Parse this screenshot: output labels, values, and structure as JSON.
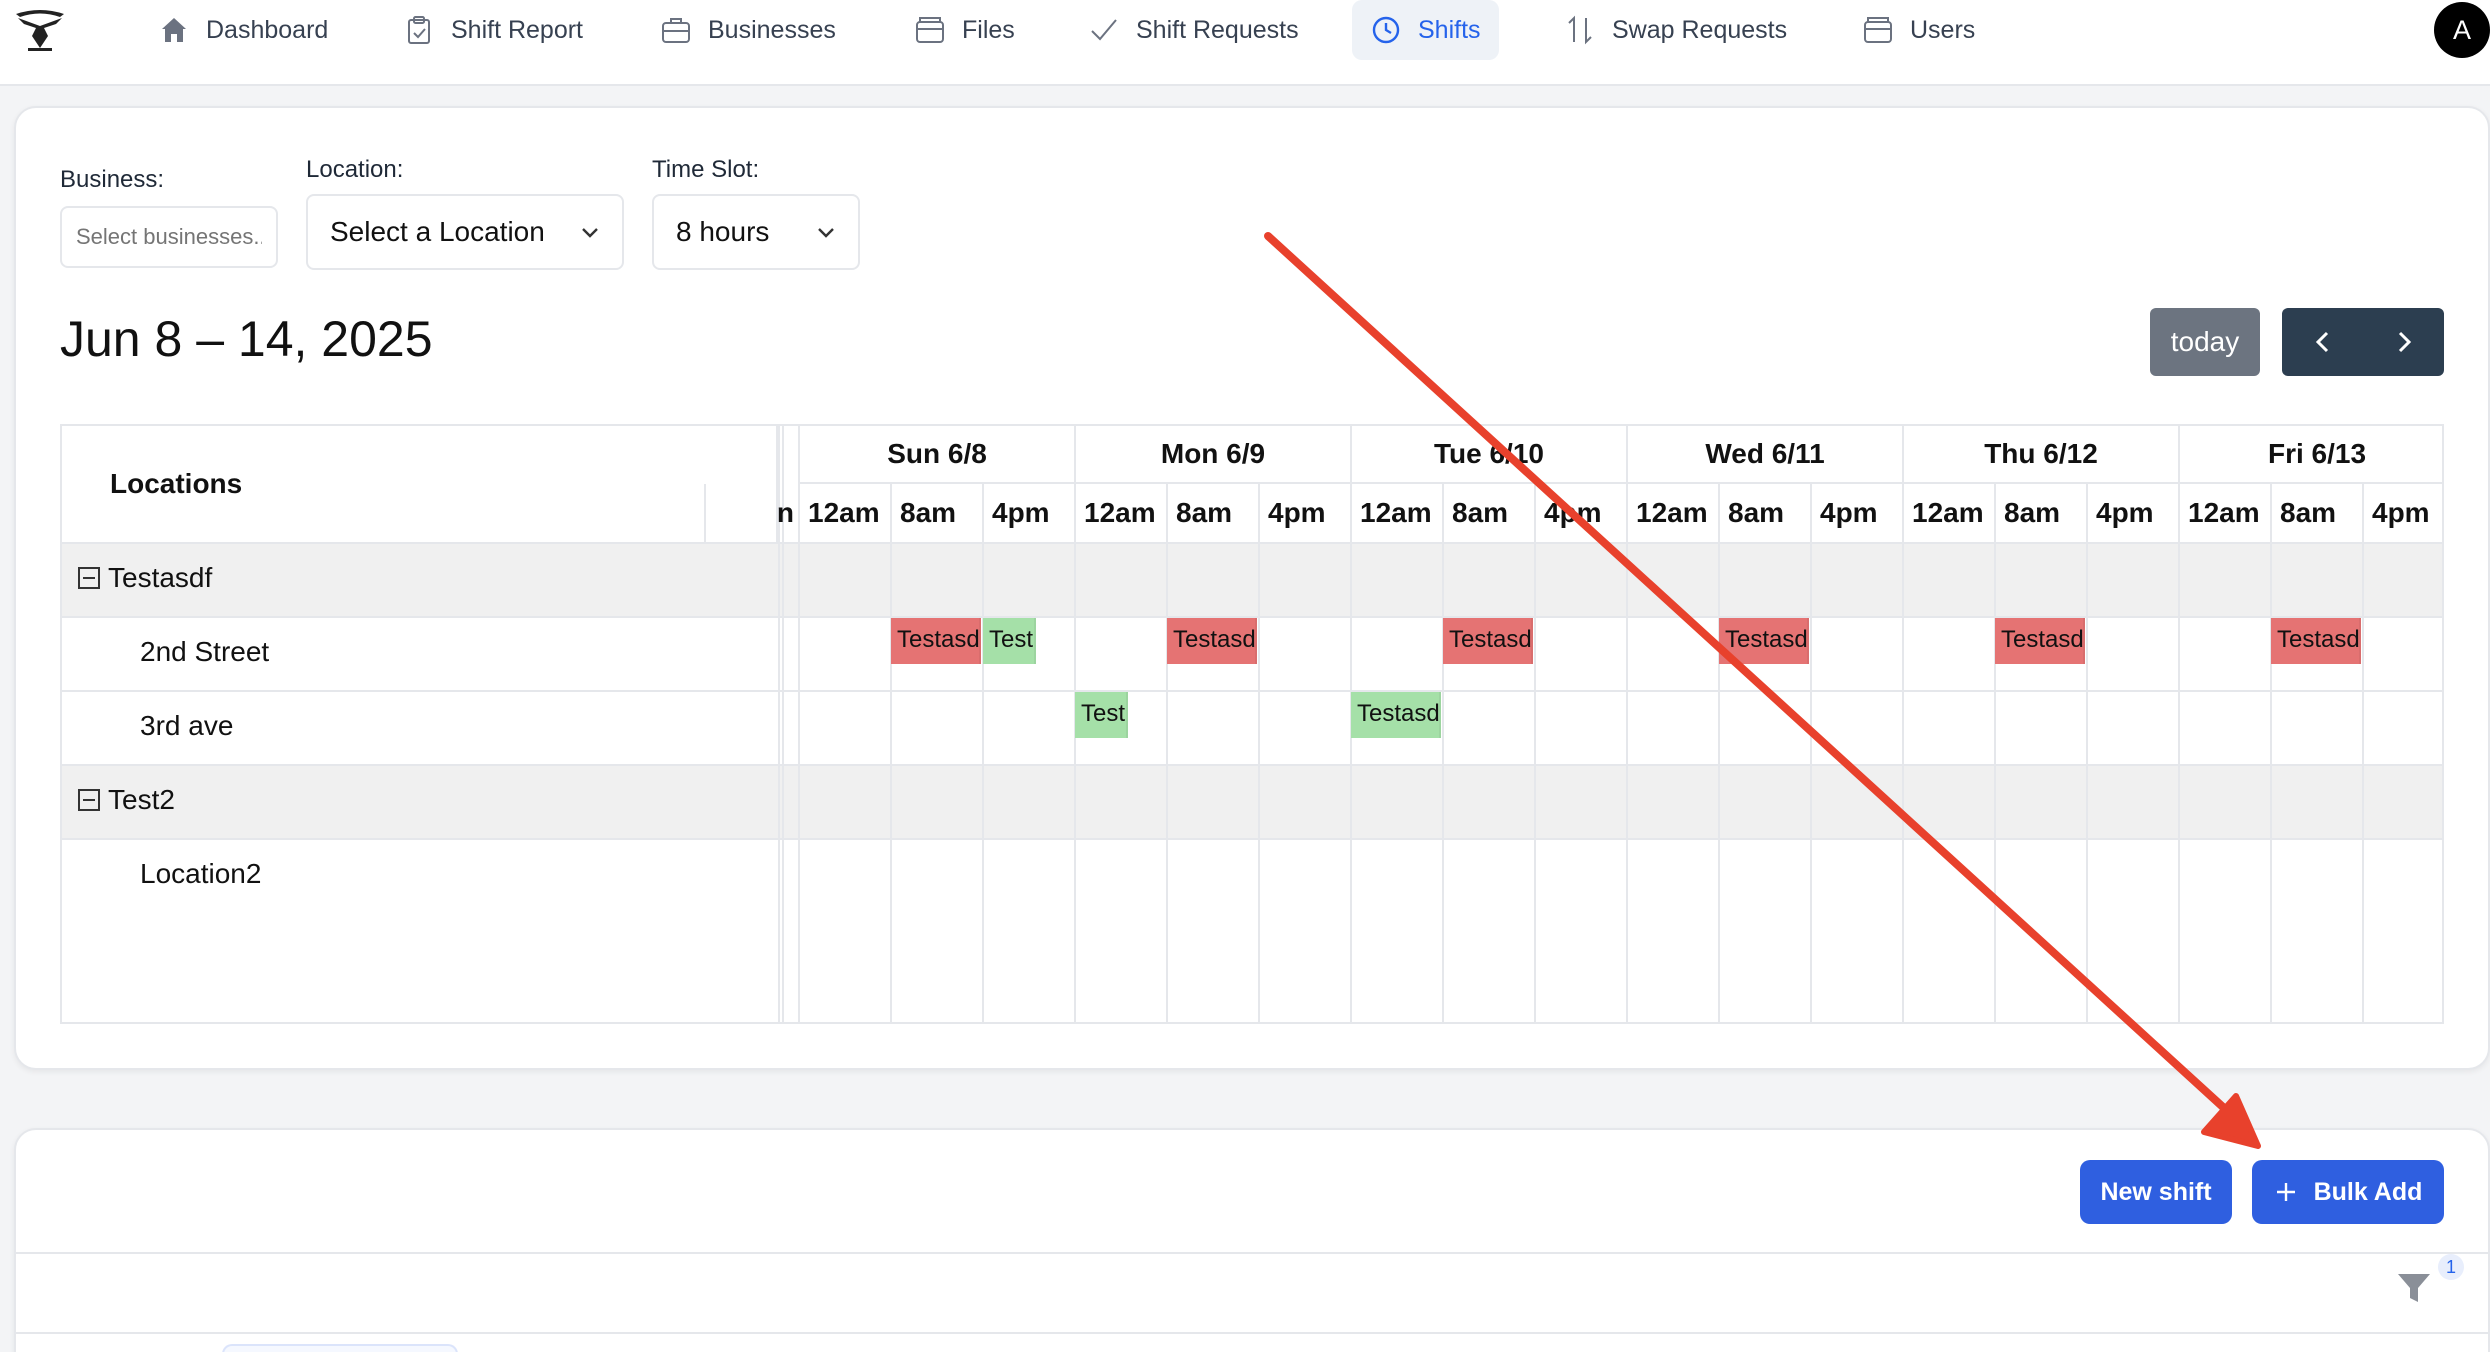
{
  "nav": {
    "items": [
      {
        "label": "Dashboard",
        "icon": "home-icon"
      },
      {
        "label": "Shift Report",
        "icon": "clipboard-icon"
      },
      {
        "label": "Businesses",
        "icon": "briefcase-icon"
      },
      {
        "label": "Files",
        "icon": "folder-icon"
      },
      {
        "label": "Shift Requests",
        "icon": "check-icon"
      },
      {
        "label": "Shifts",
        "icon": "clock-icon",
        "active": true
      },
      {
        "label": "Swap Requests",
        "icon": "swap-icon"
      },
      {
        "label": "Users",
        "icon": "users-icon"
      }
    ],
    "avatar_initial": "A"
  },
  "filters": {
    "business_label": "Business:",
    "business_placeholder": "Select businesses..",
    "location_label": "Location:",
    "location_value": "Select a Location",
    "timeslot_label": "Time Slot:",
    "timeslot_value": "8 hours"
  },
  "calendar": {
    "title": "Jun 8 – 14, 2025",
    "today_label": "today",
    "prev_icon": "chevron-left-icon",
    "next_icon": "chevron-right-icon",
    "resource_header": "Locations",
    "days": [
      "Sun 6/8",
      "Mon 6/9",
      "Tue 6/10",
      "Wed 6/11",
      "Thu 6/12",
      "Fri 6/13"
    ],
    "slot_labels": [
      "12am",
      "8am",
      "4pm"
    ],
    "groups": [
      {
        "name": "Testasdf",
        "locations": [
          "2nd Street",
          "3rd ave"
        ]
      },
      {
        "name": "Test2",
        "locations": [
          "Location2"
        ]
      }
    ],
    "events": [
      {
        "row": 1,
        "day": 0,
        "slot": 1,
        "span": 1,
        "label": "Testasdf",
        "color": "#e57373"
      },
      {
        "row": 1,
        "day": 0,
        "slot": 2,
        "span": 0.6,
        "label": "Test",
        "color": "#a5e0a8"
      },
      {
        "row": 1,
        "day": 1,
        "slot": 1,
        "span": 1,
        "label": "Testasdf",
        "color": "#e57373"
      },
      {
        "row": 1,
        "day": 2,
        "slot": 1,
        "span": 1,
        "label": "Testasdf",
        "color": "#e57373"
      },
      {
        "row": 1,
        "day": 3,
        "slot": 1,
        "span": 1,
        "label": "Testasdf",
        "color": "#e57373"
      },
      {
        "row": 1,
        "day": 4,
        "slot": 1,
        "span": 1,
        "label": "Testasdf",
        "color": "#e57373"
      },
      {
        "row": 1,
        "day": 5,
        "slot": 1,
        "span": 1,
        "label": "Testasdf",
        "color": "#e57373"
      },
      {
        "row": 2,
        "day": 1,
        "slot": 0,
        "span": 0.6,
        "label": "Test",
        "color": "#a5e0a8"
      },
      {
        "row": 2,
        "day": 2,
        "slot": 0,
        "span": 1,
        "label": "Testasdf",
        "color": "#a5e0a8"
      }
    ]
  },
  "actions": {
    "new_shift_label": "New shift",
    "bulk_add_label": "Bulk Add",
    "filter_badge": "1"
  },
  "colors": {
    "primary": "#2f5fe0",
    "active_nav": "#2563eb",
    "arrow": "#e8412c"
  }
}
